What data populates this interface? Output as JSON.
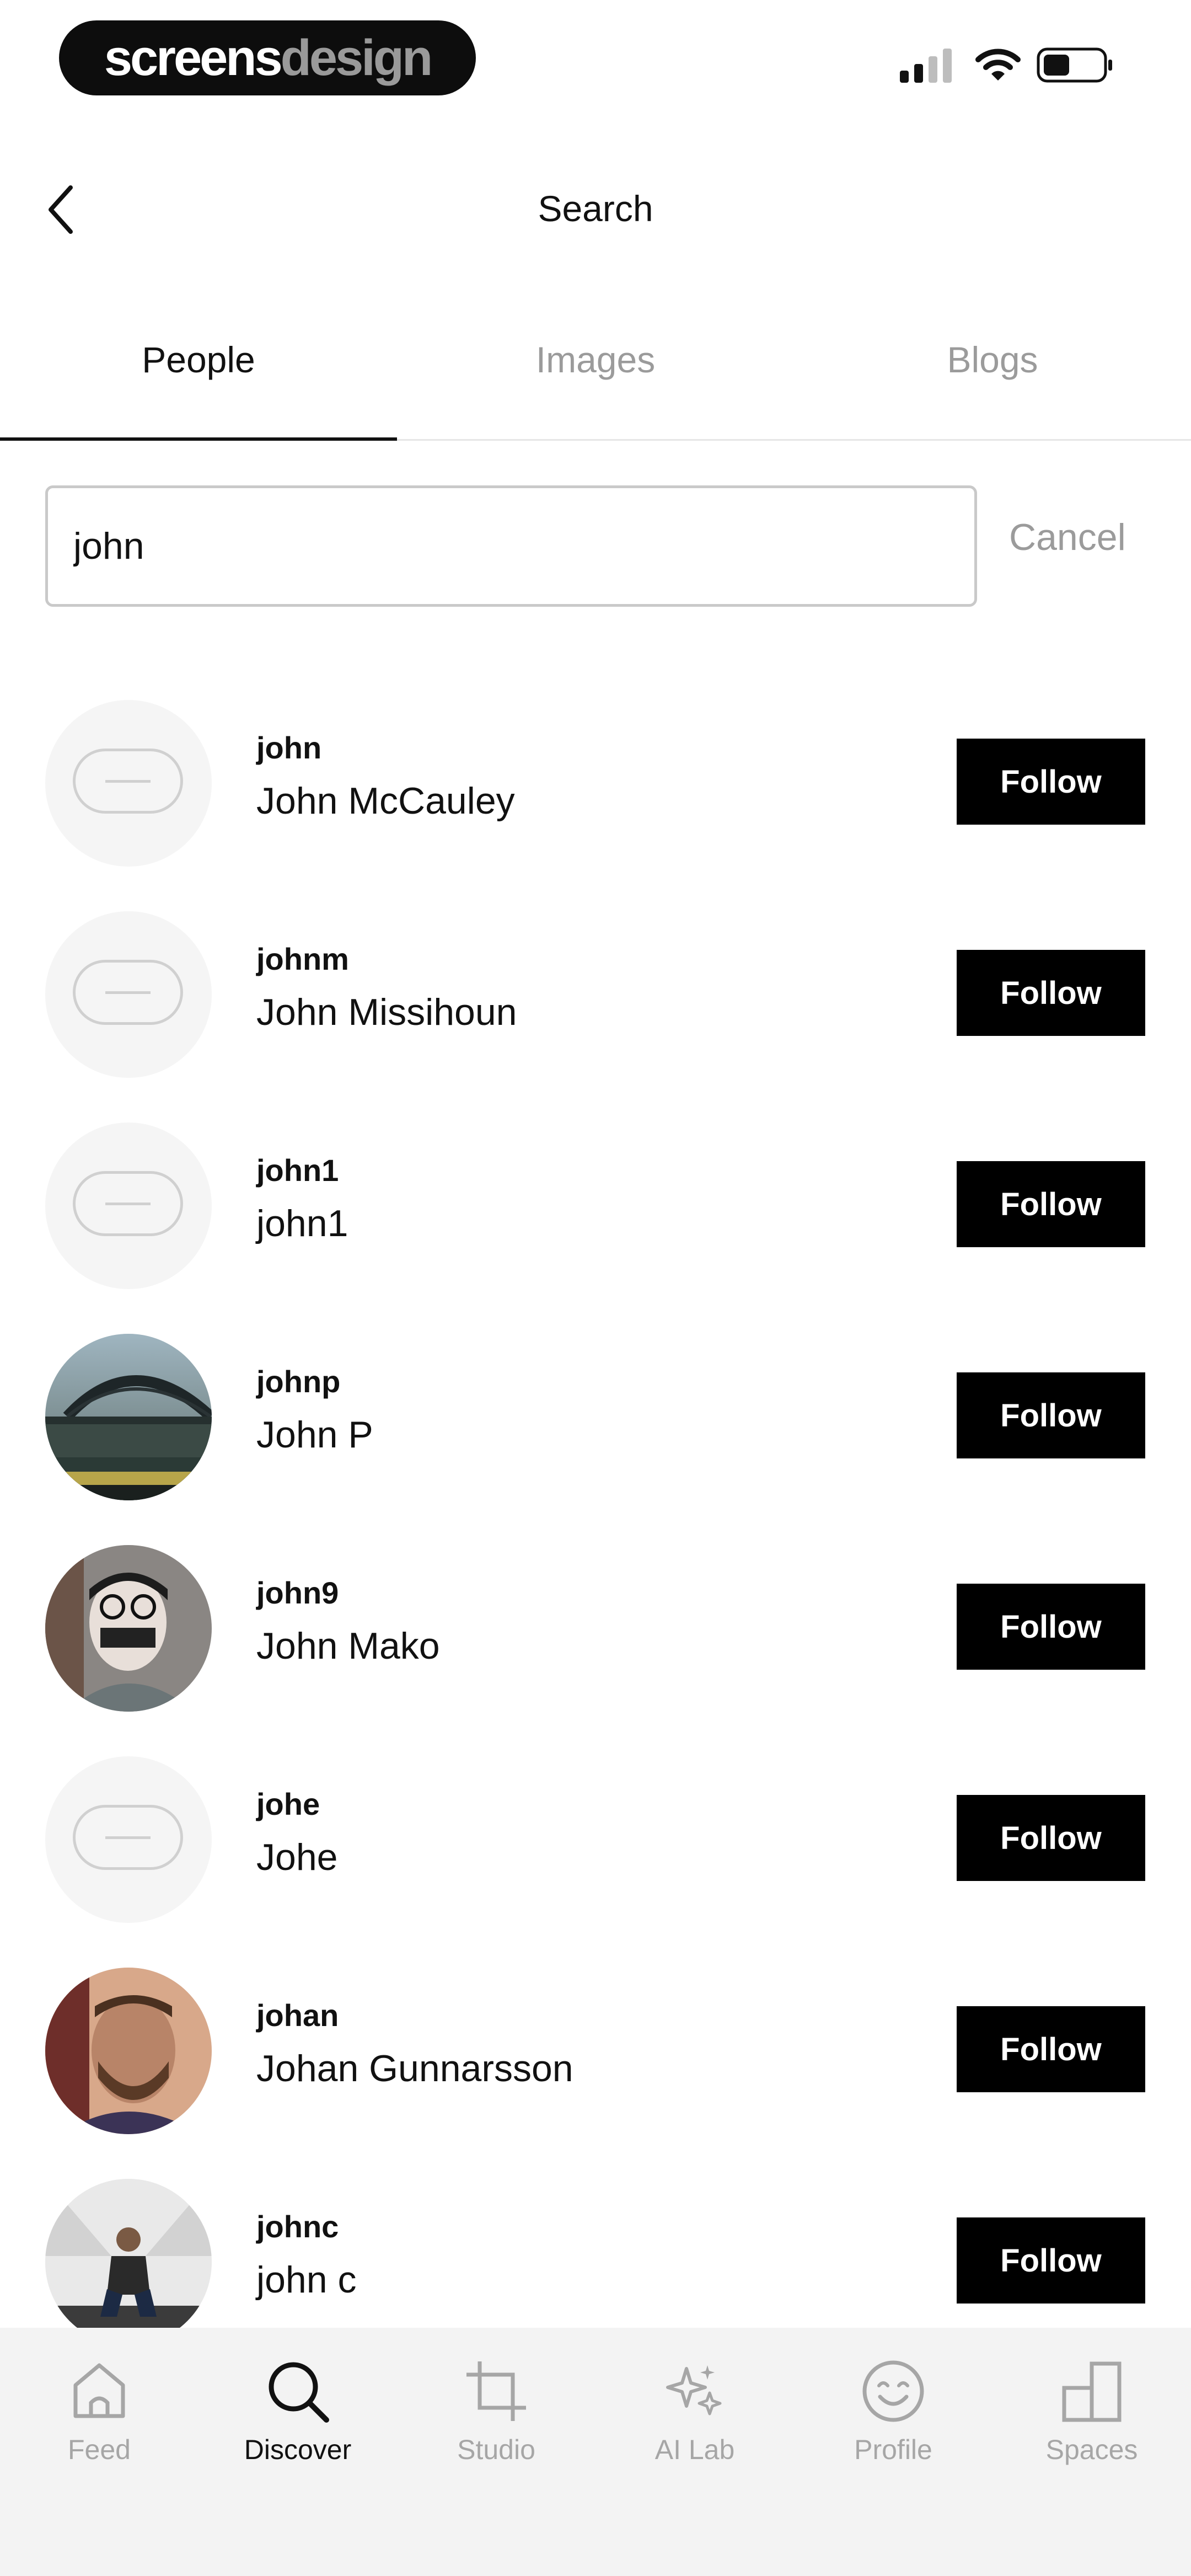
{
  "status_bar": {
    "brand_part1": "screens",
    "brand_part2": "design",
    "icons": [
      "cellular-signal-icon",
      "wifi-icon",
      "battery-icon"
    ]
  },
  "header": {
    "title": "Search",
    "back_icon": "chevron-left-icon"
  },
  "tabs": [
    {
      "label": "People",
      "active": true
    },
    {
      "label": "Images",
      "active": false
    },
    {
      "label": "Blogs",
      "active": false
    }
  ],
  "search": {
    "value": "john",
    "cancel_label": "Cancel"
  },
  "results": [
    {
      "handle": "john",
      "name": "John McCauley",
      "avatar": "placeholder",
      "follow_label": "Follow"
    },
    {
      "handle": "johnm",
      "name": "John Missihoun",
      "avatar": "placeholder",
      "follow_label": "Follow"
    },
    {
      "handle": "john1",
      "name": "john1",
      "avatar": "placeholder",
      "follow_label": "Follow"
    },
    {
      "handle": "johnp",
      "name": "John P",
      "avatar": "photo-bridge",
      "follow_label": "Follow"
    },
    {
      "handle": "john9",
      "name": "John Mako",
      "avatar": "photo-portrait-glasses",
      "follow_label": "Follow"
    },
    {
      "handle": "johe",
      "name": "Johe",
      "avatar": "placeholder",
      "follow_label": "Follow"
    },
    {
      "handle": "johan",
      "name": "Johan Gunnarsson",
      "avatar": "photo-portrait-beard",
      "follow_label": "Follow"
    },
    {
      "handle": "johnc",
      "name": "john c",
      "avatar": "photo-seated-person",
      "follow_label": "Follow"
    }
  ],
  "tabbar": [
    {
      "label": "Feed",
      "icon": "home-icon",
      "active": false
    },
    {
      "label": "Discover",
      "icon": "search-icon",
      "active": true
    },
    {
      "label": "Studio",
      "icon": "crop-icon",
      "active": false
    },
    {
      "label": "AI Lab",
      "icon": "sparkles-icon",
      "active": false
    },
    {
      "label": "Profile",
      "icon": "smiley-icon",
      "active": false
    },
    {
      "label": "Spaces",
      "icon": "spaces-icon",
      "active": false
    }
  ],
  "colors": {
    "accent": "#000000",
    "inactive": "#9b9b9b",
    "tabbar_bg": "#f3f3f3"
  }
}
